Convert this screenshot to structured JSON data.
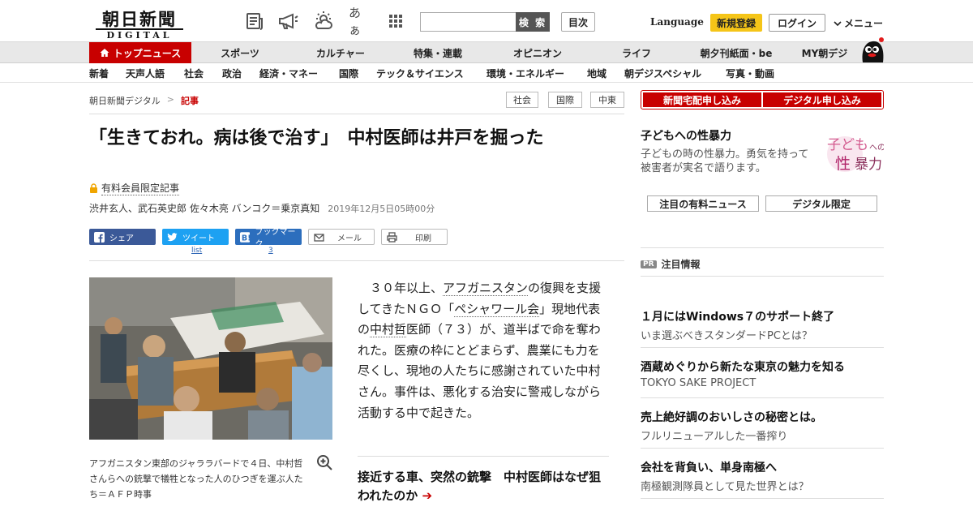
{
  "header": {
    "logo_main": "朝日新聞",
    "logo_sub": "DIGITAL",
    "icons": [
      "newspaper-icon",
      "megaphone-icon",
      "weather-icon",
      "font-size-icon",
      "grid-menu-icon"
    ],
    "font_size_label": "あぁ",
    "search_placeholder": "",
    "search_button": "検 索",
    "toc_button": "目次",
    "language": "Language",
    "signup": "新規登録",
    "login": "ログイン",
    "menu": "メニュー"
  },
  "nav_primary": [
    {
      "label": "トップニュース",
      "active": true
    },
    {
      "label": "スポーツ"
    },
    {
      "label": "カルチャー"
    },
    {
      "label": "特集・連載"
    },
    {
      "label": "オピニオン"
    },
    {
      "label": "ライフ"
    },
    {
      "label": "朝夕刊紙面・be"
    },
    {
      "label": "MY朝デジ"
    }
  ],
  "nav_secondary": [
    "新着",
    "天声人語",
    "社会",
    "政治",
    "経済・マネー",
    "国際",
    "テック＆サイエンス",
    "環境・エネルギー",
    "地域",
    "朝デジスペシャル",
    "写真・動画"
  ],
  "breadcrumb": {
    "home": "朝日新聞デジタル",
    "sep": ">",
    "current": "記事"
  },
  "tags": [
    "社会",
    "国際",
    "中東"
  ],
  "article": {
    "title": "「生きておれ。病は後で治す」　中村医師は井戸を掘った",
    "members_label": "有料会員限定記事",
    "byline": "渋井玄人、武石英史郎 佐々木亮 バンコク＝乗京真知",
    "date": "2019年12月5日05時00分",
    "body_p1": "３０年以上、",
    "body_link1": "アフガニスタン",
    "body_p2": "の復興を支援してきたＮＧＯ「",
    "body_link2": "ペシャワール会",
    "body_p3": "」現地代表の",
    "body_link3": "中村哲",
    "body_p4": "医師（７３）が、道半ばで命を奪われた。医療の枠にとどまらず、農業にも力を尽くし、現地の人たちに感謝されていた中村さん。事件は、悪化する治安に警戒しながら活動する中で起きた。",
    "caption": "アフガニスタン東部のジャララバードで４日、中村哲さんらへの銃撃で犠牲となった人のひつぎを運ぶ人たち＝ＡＦＰ時事",
    "related_title": "接近する車、突然の銃撃　中村医師はなぜ狙われたのか",
    "related_arrow": "➔"
  },
  "share": {
    "facebook": "シェア",
    "twitter": "ツイート",
    "twitter_count": "list",
    "hatena": "ブックマーク",
    "hatena_count": "3",
    "mail": "メール",
    "print": "印刷"
  },
  "sidebar": {
    "subscribe_paper": "新聞宅配申し込み",
    "subscribe_digital": "デジタル申し込み",
    "promo_title": "子どもへの性暴力",
    "promo_desc": "子どもの時の性暴力。勇気を持って被害者が実名で語ります。",
    "promo_img_text1": "子ども",
    "promo_img_text2": "への",
    "promo_img_text3": "性",
    "promo_img_text4": "暴力",
    "btn_paid_news": "注目の有料ニュース",
    "btn_digital_only": "デジタル限定",
    "pr_badge": "PR",
    "pr_heading": "注目情報",
    "pr_items": [
      {
        "title": "１月にはWindows７のサポート終了",
        "sub": "いま選ぶべきスタンダードPCとは？"
      },
      {
        "title": "酒蔵めぐりから新たな東京の魅力を知る",
        "sub": "TOKYO SAKE PROJECT"
      },
      {
        "title": "売上絶好調のおいしさの秘密とは。",
        "sub": "フルリニューアルした一番搾り"
      },
      {
        "title": "会社を背負い、単身南極へ",
        "sub": "南極観測隊員として見た世界とは？"
      }
    ]
  },
  "colors": {
    "accent": "#c80000",
    "signup": "#f5c518",
    "facebook": "#3b5998",
    "twitter": "#1da1f2",
    "hatena": "#2c6ebd"
  }
}
